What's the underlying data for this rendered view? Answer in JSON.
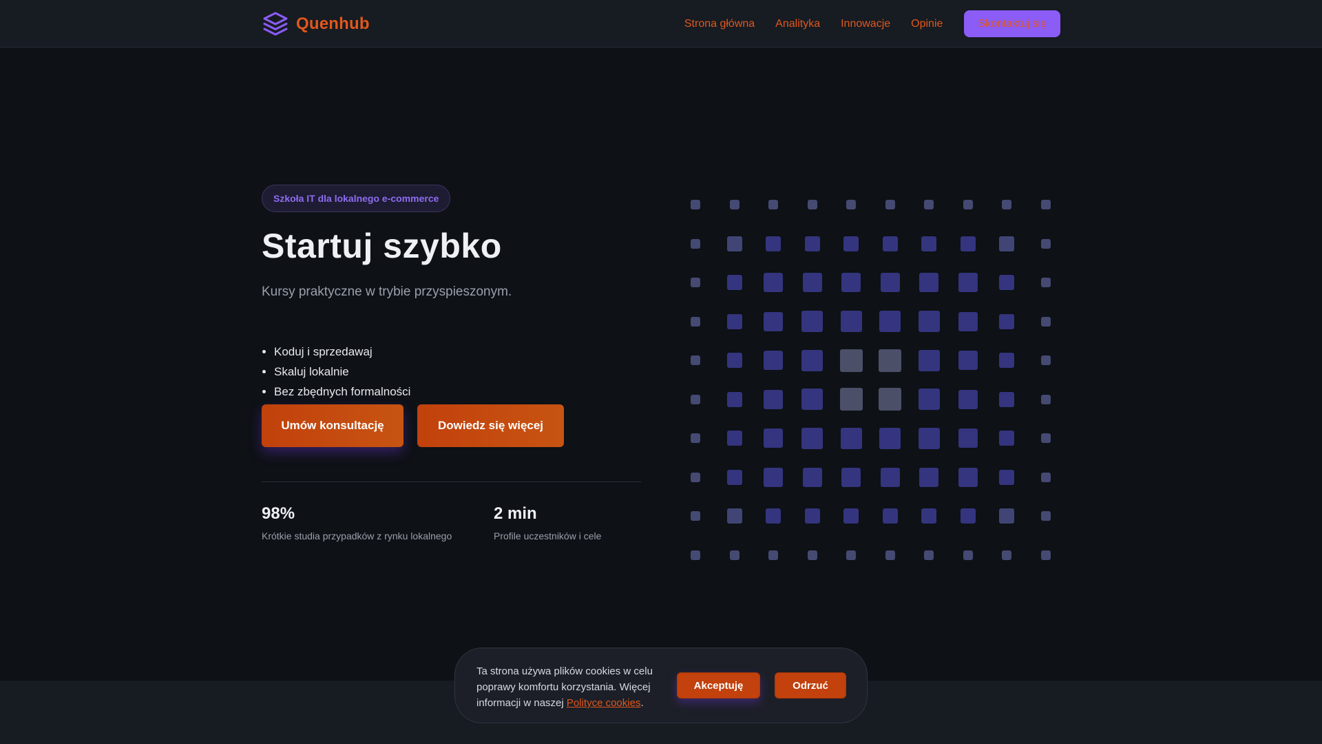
{
  "header": {
    "brand": "Quenhub",
    "nav": [
      "Strona główna",
      "Analityka",
      "Innowacje",
      "Opinie"
    ],
    "cta": "Skontaktuj się"
  },
  "hero": {
    "badge": "Szkoła IT dla lokalnego e-commerce",
    "title": "Startuj szybko",
    "subtitle": "Kursy praktyczne w trybie przyspieszonym.",
    "features": [
      "Koduj i sprzedawaj",
      "Skaluj lokalnie",
      "Bez zbędnych formalności"
    ],
    "primary_button": "Umów konsultację",
    "secondary_button": "Dowiedz się więcej",
    "stats": [
      {
        "value": "98%",
        "label": "Krótkie studia przypadków z rynku lokalnego"
      },
      {
        "value": "2 min",
        "label": "Profile uczestników i cele"
      }
    ]
  },
  "cookie": {
    "text_before": "Ta strona używa plików cookies w celu poprawy komfortu korzystania. Więcej informacji w naszej ",
    "link": "Polityce cookies",
    "text_after": ".",
    "accept": "Akceptuję",
    "reject": "Odrzuć"
  },
  "colors": {
    "accent": "#e0581c",
    "brand_purple": "#8b5cf6",
    "button": "#c2410c",
    "background": "#0e1116"
  },
  "icons": {
    "logo": "stacked-layers-icon"
  }
}
